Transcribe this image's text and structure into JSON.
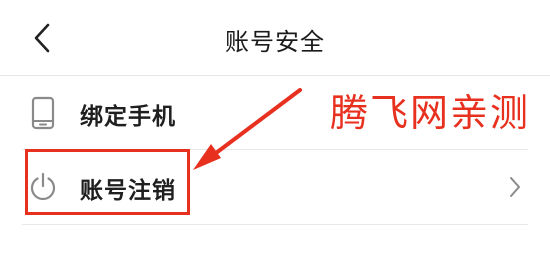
{
  "header": {
    "title": "账号安全",
    "back_icon": "chevron-left-icon"
  },
  "rows": [
    {
      "label": "绑定手机",
      "icon": "phone-icon",
      "has_chevron": false
    },
    {
      "label": "账号注销",
      "icon": "power-icon",
      "has_chevron": true
    }
  ],
  "annotation": {
    "text": "腾飞网亲测",
    "color": "#e8301f"
  },
  "colors": {
    "background": "#ffffff",
    "text": "#1f1f1f",
    "icon": "#8a8a8a",
    "divider": "#e8e8e8",
    "highlight": "#e8301f"
  }
}
